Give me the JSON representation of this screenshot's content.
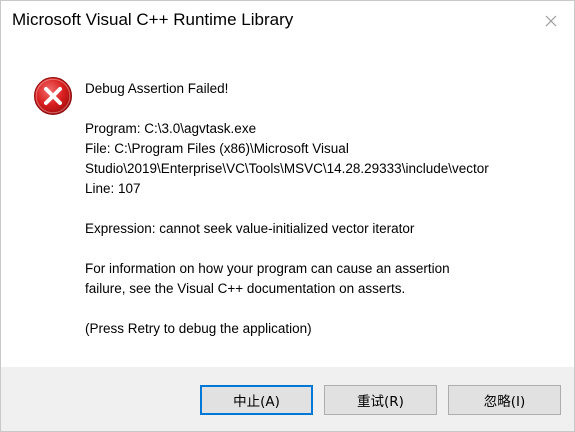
{
  "window": {
    "title": "Microsoft Visual C++ Runtime Library"
  },
  "icons": {
    "error": "error-icon",
    "close": "close-icon"
  },
  "message": {
    "heading": "Debug Assertion Failed!",
    "program": "Program: C:\\3.0\\agvtask.exe",
    "file_line1": "File: C:\\Program Files (x86)\\Microsoft Visual",
    "file_line2": "Studio\\2019\\Enterprise\\VC\\Tools\\MSVC\\14.28.29333\\include\\vector",
    "line": "Line: 107",
    "expression": "Expression: cannot seek value-initialized vector iterator",
    "info_line1": "For information on how your program can cause an assertion",
    "info_line2": "failure, see the Visual C++ documentation on asserts.",
    "retry_hint": "(Press Retry to debug the application)"
  },
  "buttons": {
    "abort": "中止(A)",
    "retry": "重试(R)",
    "ignore": "忽略(I)"
  },
  "colors": {
    "error_red": "#d81e1e",
    "focus_blue": "#0078d7",
    "footer_bg": "#f0f0f0"
  }
}
